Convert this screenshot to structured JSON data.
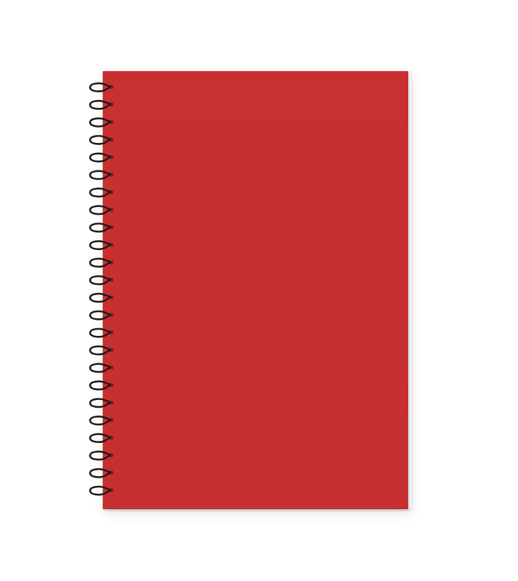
{
  "scene": {
    "background_color": "#ffffff"
  },
  "notebook": {
    "cover_color": "#c93030",
    "page_edge_color": "#f4f4f4",
    "binding": "spiral",
    "coil_color": "#1c1c1c",
    "coil_count": 24
  }
}
